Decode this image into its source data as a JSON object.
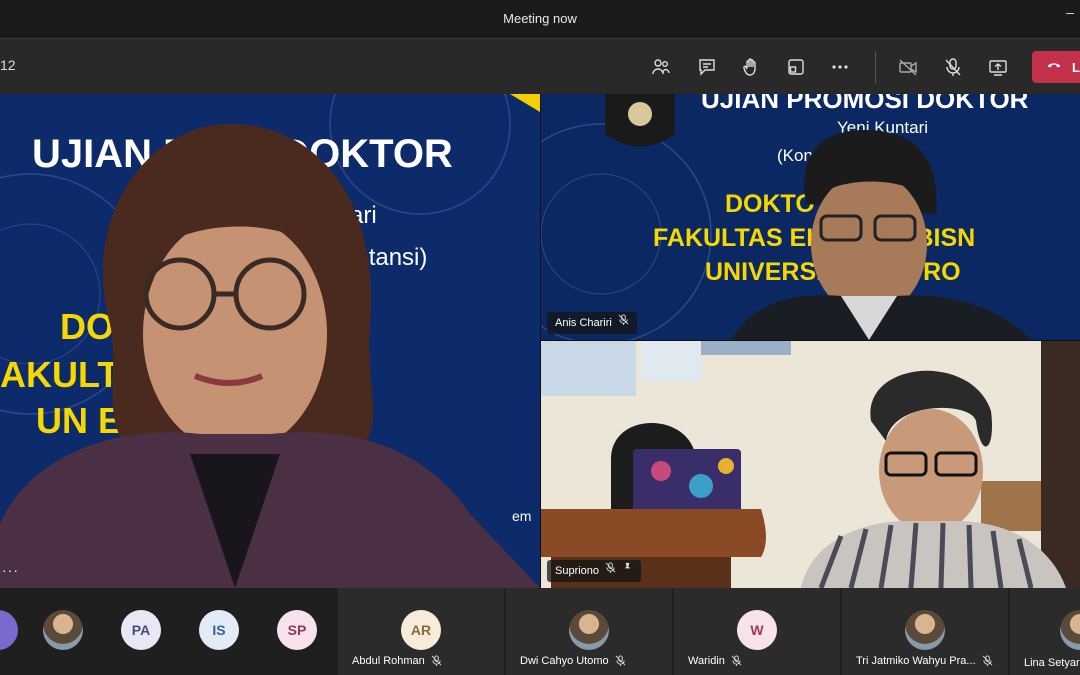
{
  "window": {
    "title": "Meeting now",
    "minimize": "–"
  },
  "toolbar": {
    "timer": "12",
    "icons": [
      "participants-icon",
      "chat-icon",
      "raise-hand-icon",
      "rooms-icon",
      "more-icon",
      "camera-off-icon",
      "mic-off-icon",
      "share-icon"
    ],
    "leave_label": "L",
    "leave_color": "#c4314b"
  },
  "main_slide": {
    "line1": "UJIAN P    OSI DOKTOR",
    "line2": "ntari",
    "line3": "kuntansi)",
    "line4": "DO          KONOMI",
    "line5": "AKULT           DAN BIS",
    "line6": "UN              EGORO",
    "corner": "em",
    "more": "···"
  },
  "top_right": {
    "line1": "UJIAN PROMOSI DOKTOR",
    "line2": "Yeni Kuntari",
    "line3": "(Kon          Akuntansi)",
    "line4": "DOKTO          KONOMI",
    "line5": "FAKULTAS EK          A DAN BISN",
    "line6": "UNIVERSI          ONEGORO",
    "name": "Anis Chariri"
  },
  "bottom_right": {
    "name": "Supriono"
  },
  "strip": {
    "avatars": [
      {
        "initials": "PA",
        "color": "#e8e8f4",
        "text": "#4b4b7a"
      },
      {
        "initials": "IS",
        "color": "#e3ecf6",
        "text": "#3a5f8a"
      },
      {
        "initials": "SP",
        "color": "#f6e3ec",
        "text": "#8a3a5f"
      }
    ],
    "participants": [
      {
        "name": "Abdul Rohman",
        "initials": "AR",
        "color": "#f6ecd9",
        "text": "#8a6a3a"
      },
      {
        "name": "Dwi Cahyo Utomo",
        "initials": "",
        "color": "",
        "text": ""
      },
      {
        "name": "Waridin",
        "initials": "W",
        "color": "#f8e3ea",
        "text": "#a03a5a"
      },
      {
        "name": "Tri Jatmiko Wahyu Pra...",
        "initials": "",
        "color": "",
        "text": ""
      },
      {
        "name": "Lina Setyarin",
        "initials": "",
        "color": "",
        "text": ""
      }
    ]
  }
}
